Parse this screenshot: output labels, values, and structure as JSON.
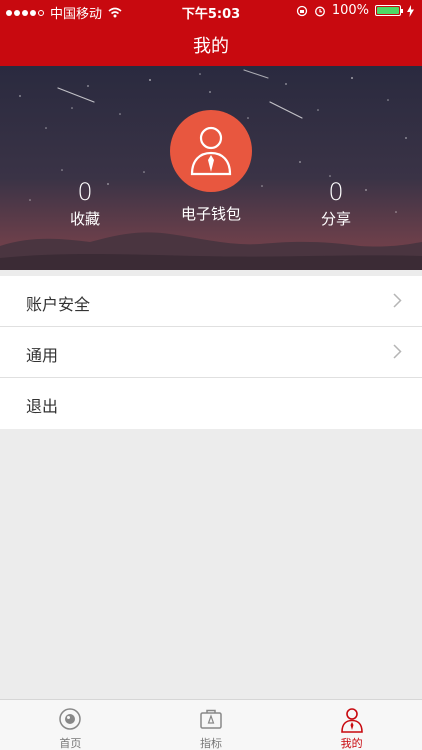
{
  "status_bar": {
    "carrier": "中国移动",
    "time": "下午5:03",
    "battery": "100%"
  },
  "nav": {
    "title": "我的"
  },
  "profile": {
    "favorites_count": "0",
    "favorites_label": "收藏",
    "wallet_label": "电子钱包",
    "share_count": "0",
    "share_label": "分享"
  },
  "menu": {
    "items": [
      {
        "label": "账户安全"
      },
      {
        "label": "通用"
      },
      {
        "label": "退出"
      }
    ]
  },
  "tabbar": {
    "tabs": [
      {
        "label": "首页"
      },
      {
        "label": "指标"
      },
      {
        "label": "我的"
      }
    ]
  },
  "colors": {
    "brand": "#c8090f",
    "avatar": "#e8573f",
    "background": "#ececec"
  }
}
